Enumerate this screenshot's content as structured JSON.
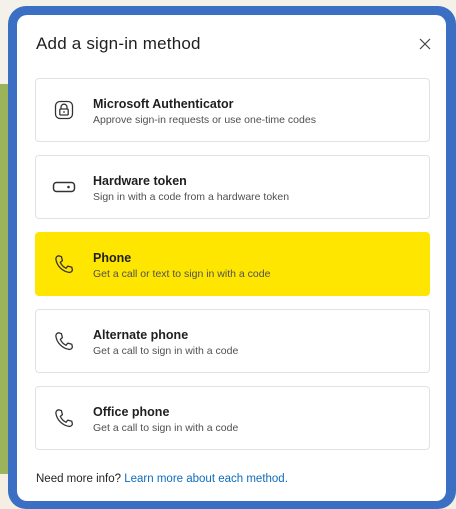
{
  "dialog": {
    "title": "Add a sign-in method",
    "close_icon": "close-icon",
    "options": [
      {
        "title": "Microsoft Authenticator",
        "description": "Approve sign-in requests or use one-time codes",
        "icon": "authenticator-lock-icon",
        "highlighted": false
      },
      {
        "title": "Hardware token",
        "description": "Sign in with a code from a hardware token",
        "icon": "hardware-token-icon",
        "highlighted": false
      },
      {
        "title": "Phone",
        "description": "Get a call or text to sign in with a code",
        "icon": "phone-icon",
        "highlighted": true
      },
      {
        "title": "Alternate phone",
        "description": "Get a call to sign in with a code",
        "icon": "phone-icon",
        "highlighted": false
      },
      {
        "title": "Office phone",
        "description": "Get a call to sign in with a code",
        "icon": "phone-icon",
        "highlighted": false
      }
    ],
    "footer": {
      "text": "Need more info?",
      "link_text": "Learn more about each method."
    }
  },
  "colors": {
    "frame": "#3a6fc4",
    "highlight": "#ffe600",
    "link": "#0f6cbd",
    "side_strip": "#9bb35a"
  }
}
